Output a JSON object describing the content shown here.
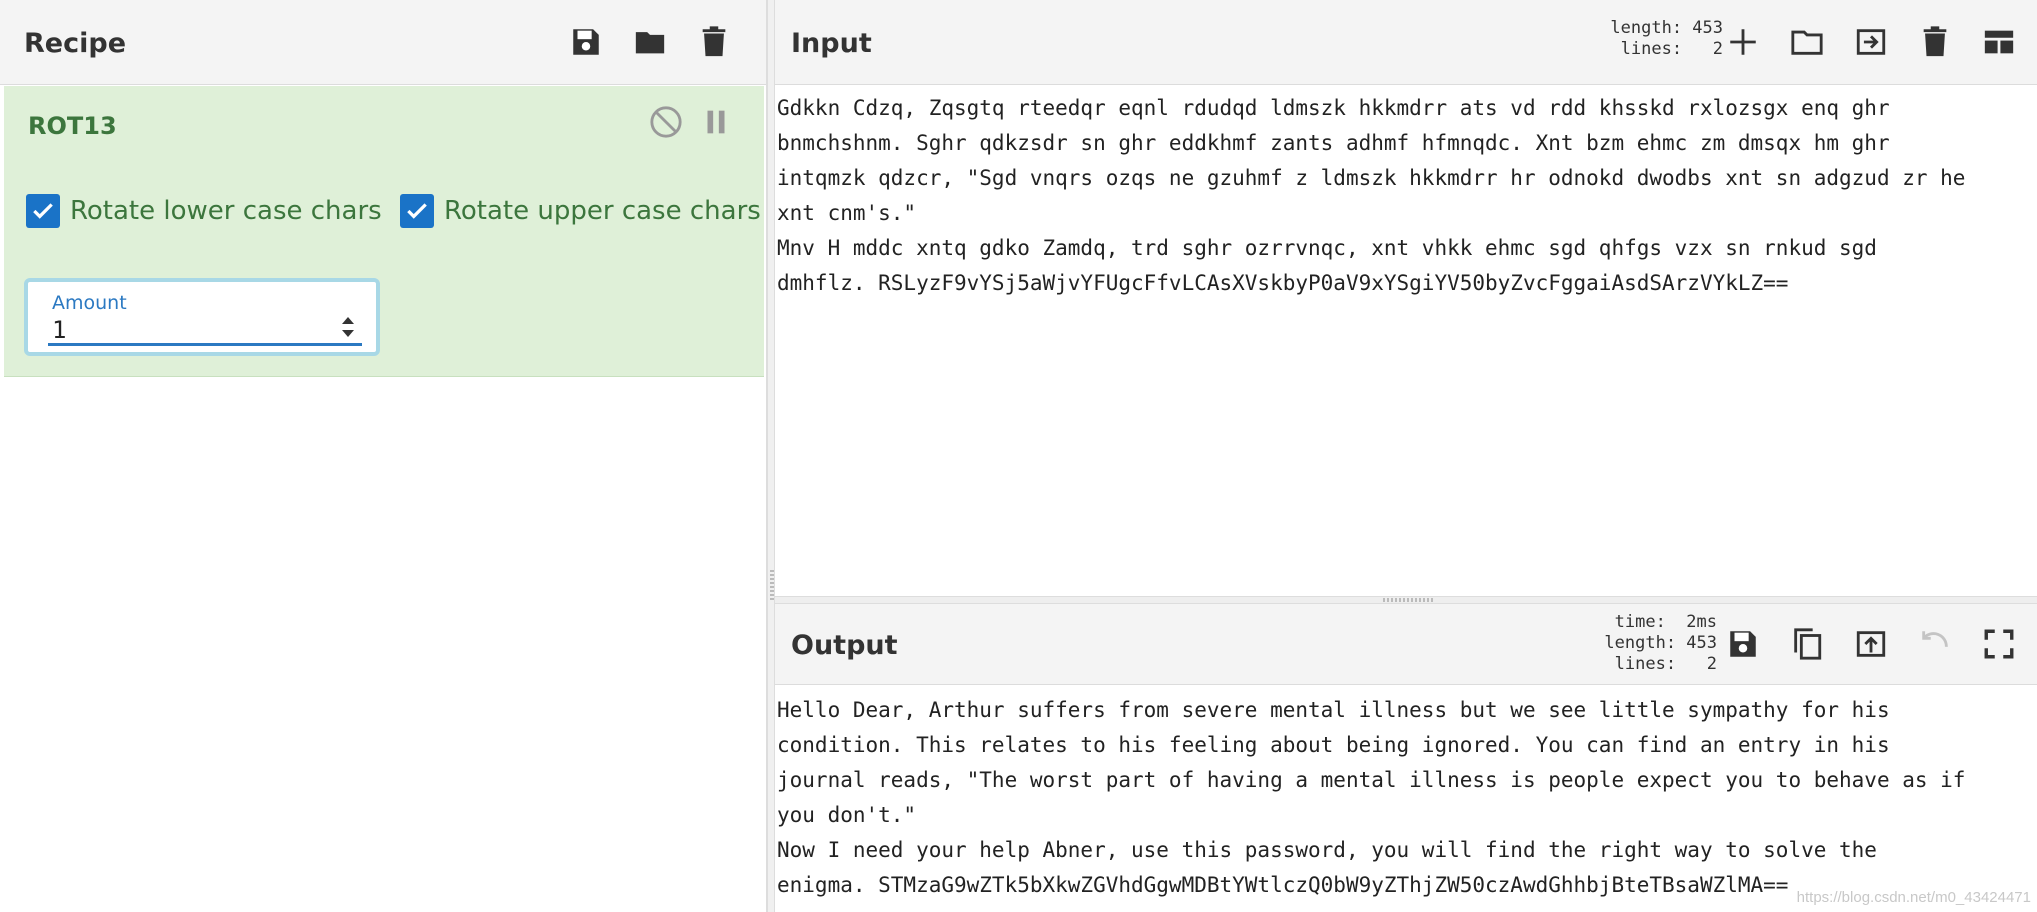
{
  "recipe": {
    "title": "Recipe",
    "operation": {
      "name": "ROT13",
      "checkbox_lower": "Rotate lower case chars",
      "checkbox_upper": "Rotate upper case chars",
      "amount_label": "Amount",
      "amount_value": "1"
    }
  },
  "input": {
    "title": "Input",
    "stats": "length: 453\n lines:   2",
    "text": "Gdkkn Cdzq, Zqsgtq rteedqr eqnl rdudqd ldmszk hkkmdrr ats vd rdd khsskd rxlozsgx enq ghr\nbnmchshnm. Sghr qdkzsdr sn ghr eddkhmf zants adhmf hfmnqdc. Xnt bzm ehmc zm dmsqx hm ghr\nintqmzk qdzcr, \"Sgd vnqrs ozqs ne gzuhmf z ldmszk hkkmdrr hr odnokd dwodbs xnt sn adgzud zr he\nxnt cnm's.\"\nMnv H mddc xntq gdko Zamdq, trd sghr ozrrvnqc, xnt vhkk ehmc sgd qhfgs vzx sn rnkud sgd\ndmhflz. RSLyzF9vYSj5aWjvYFUgcFfvLCAsXVskbyP0aV9xYSgiYV50byZvcFggaiAsdSArzVYkLZ=="
  },
  "output": {
    "title": "Output",
    "stats": "  time:  2ms\nlength: 453\n lines:   2",
    "text": "Hello Dear, Arthur suffers from severe mental illness but we see little sympathy for his\ncondition. This relates to his feeling about being ignored. You can find an entry in his\njournal reads, \"The worst part of having a mental illness is people expect you to behave as if\nyou don't.\"\nNow I need your help Abner, use this password, you will find the right way to solve the\nenigma. STMzaG9wZTk5bXkwZGVhdGgwMDBtYWtlczQ0bW9yZThjZW50czAwdGhhbjBteTBsaWZlMA==",
    "watermark": "https://blog.csdn.net/m0_43424471"
  }
}
